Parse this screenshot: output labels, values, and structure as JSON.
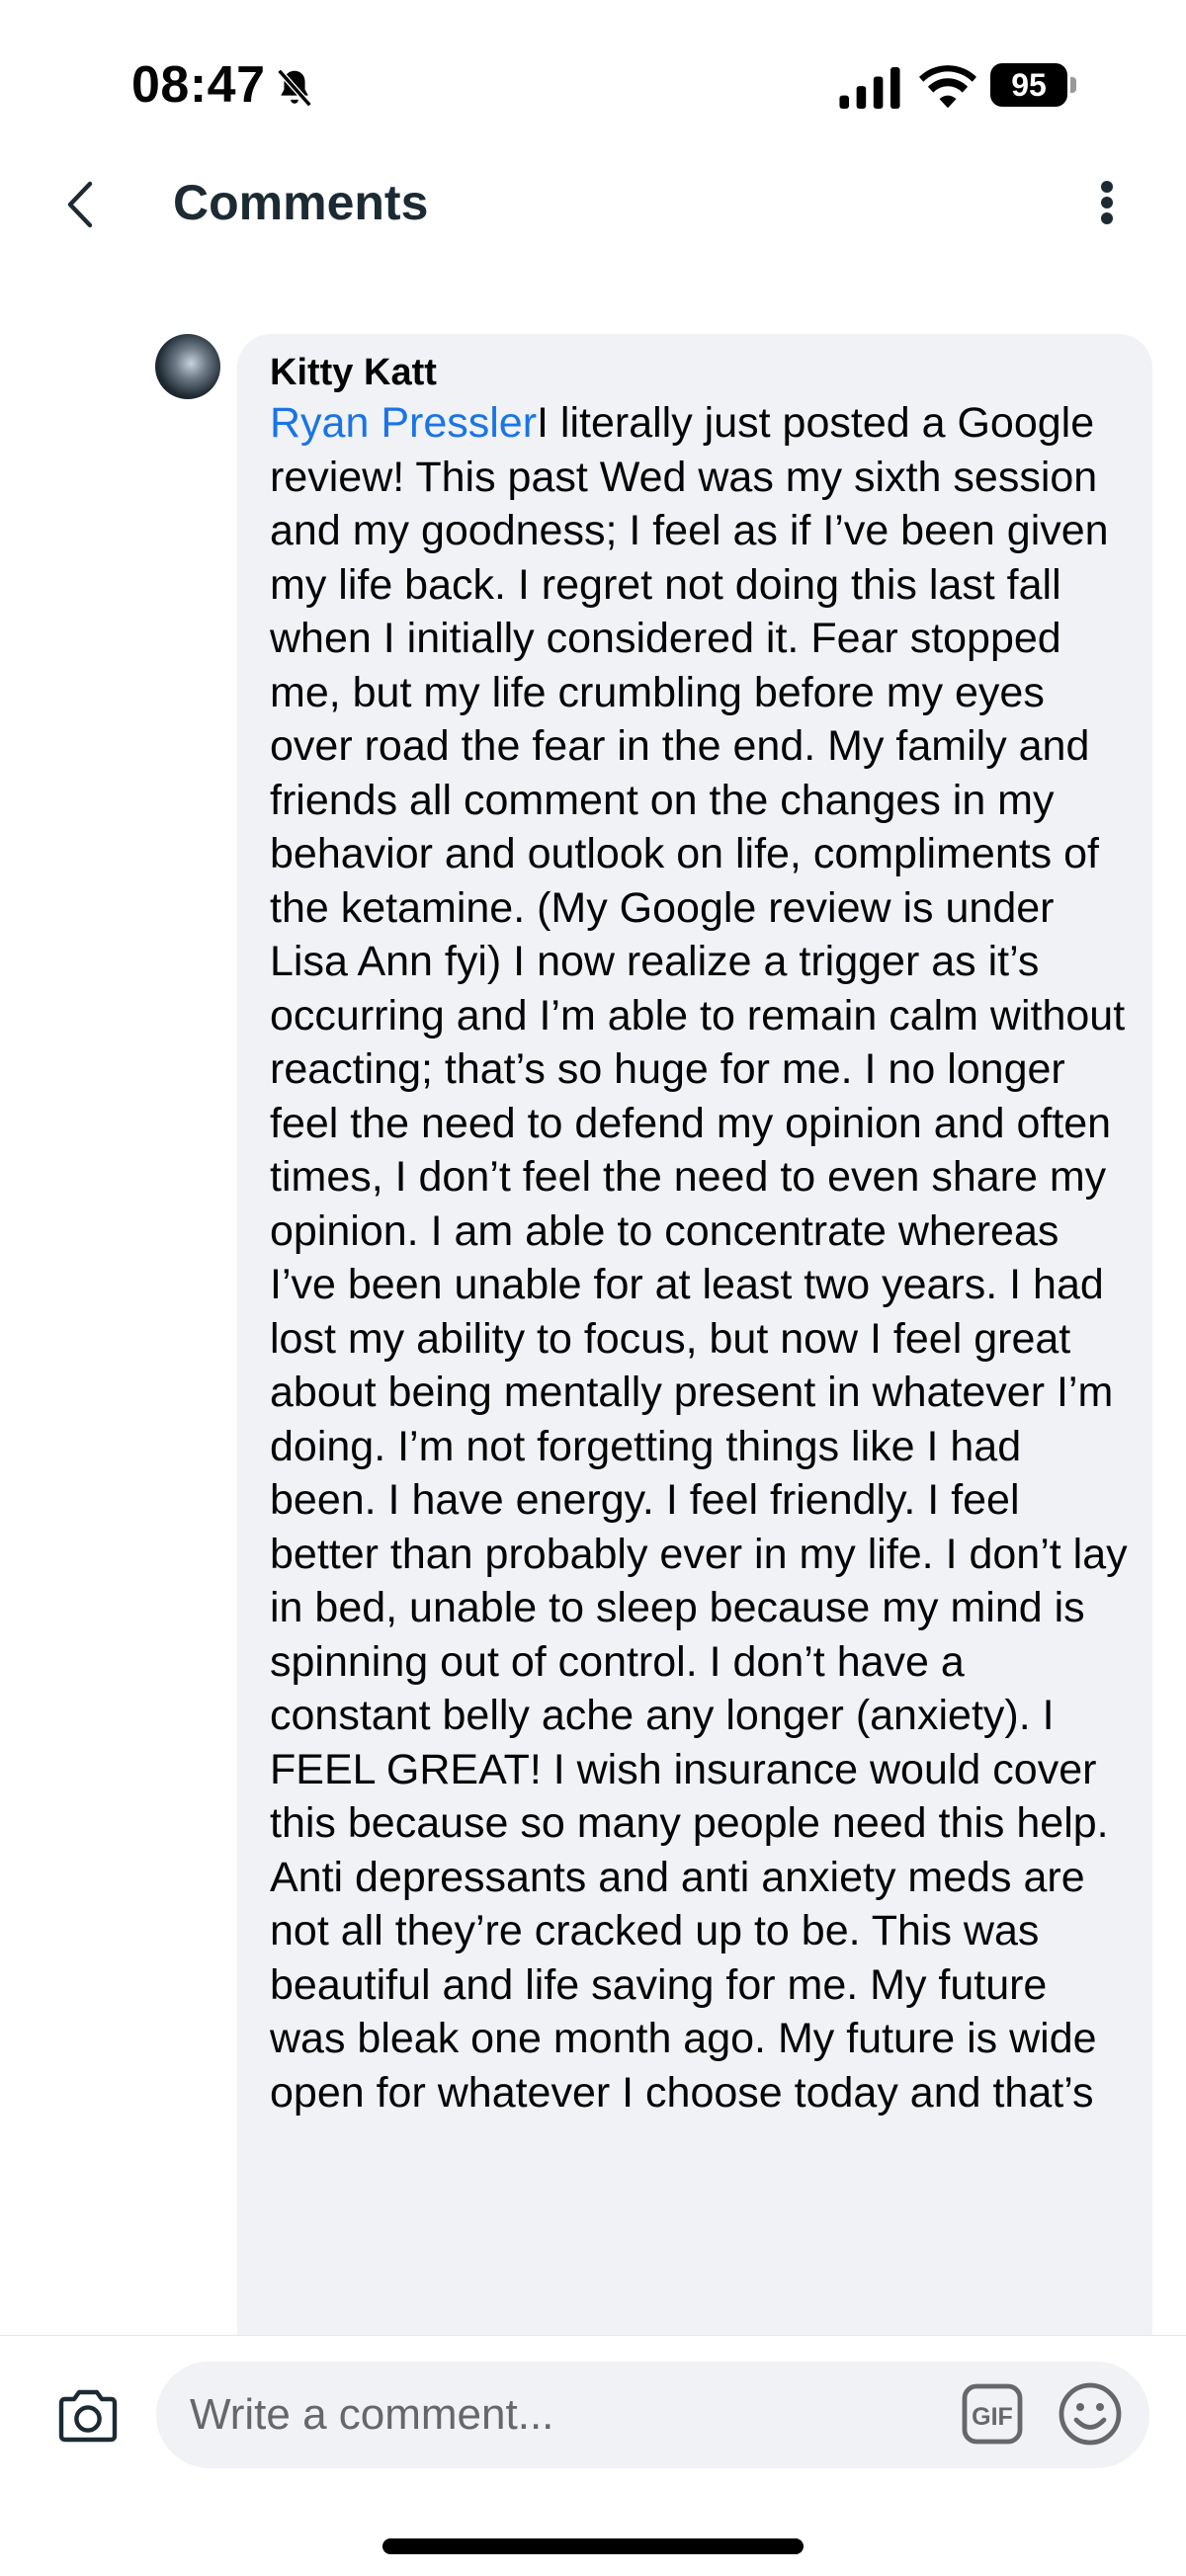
{
  "status_bar": {
    "time": "08:47",
    "battery": "95",
    "icons": [
      "bell-slash-icon",
      "cellular-signal-icon",
      "wifi-icon",
      "battery-icon"
    ]
  },
  "header": {
    "title": "Comments",
    "back_icon": "chevron-left-icon",
    "more_icon": "more-vertical-icon"
  },
  "comment": {
    "author": "Kitty Katt",
    "mention": "Ryan Pressler",
    "text": "I literally just posted a Google review! This past Wed was my sixth session and my goodness; I feel as if I’ve been given my life back. I regret not doing this last fall when I initially considered it. Fear stopped me, but my life crumbling before my eyes over road the fear in the end. My family and friends all comment on the changes in my behavior and outlook on life, compliments of the ketamine. (My Google review is under Lisa Ann fyi) I now realize a trigger as it’s occurring and I’m able to remain calm without reacting; that’s so huge for me. I no longer feel the need to defend my opinion and often times, I don’t feel the need to even share my opinion. I am able to concentrate whereas I’ve been unable for at least two years. I had lost my ability to focus, but now I feel great about being mentally present in whatever I’m doing. I’m not forgetting things like I had been. I have energy. I feel friendly. I feel better than probably ever in my life. I don’t lay in bed, unable to sleep because my mind is spinning out of control. I don’t have a constant belly ache any longer (anxiety). I FEEL GREAT!  I wish insurance would cover this because so many people need this help. Anti depressants and anti anxiety meds are not all they’re cracked up to be. This was beautiful and life saving for me. My future was bleak one month ago. My future is wide open for whatever I choose today and that’s"
  },
  "composer": {
    "placeholder": "Write a comment...",
    "gif_label": "GIF",
    "camera_icon": "camera-icon",
    "emoji_icon": "emoji-icon"
  },
  "colors": {
    "mention": "#1b74e4",
    "bubble": "#f0f2f5",
    "title": "#1c2b33"
  }
}
